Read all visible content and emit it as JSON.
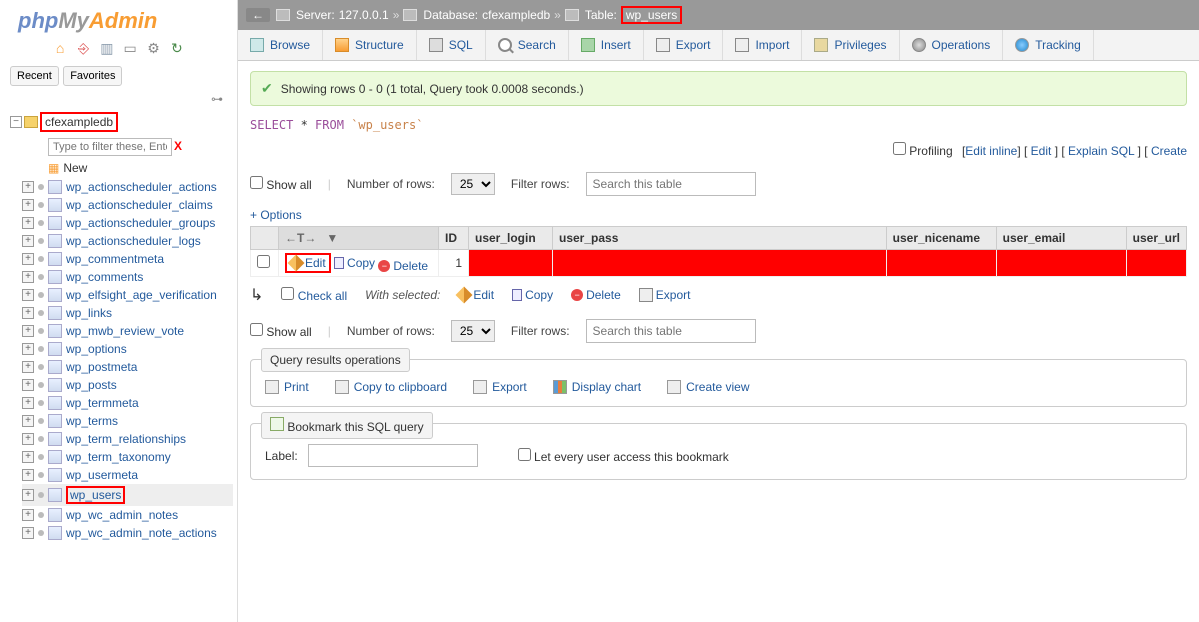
{
  "logo": {
    "p1": "php",
    "p2": "My",
    "p3": "Admin"
  },
  "rf": {
    "recent": "Recent",
    "favorites": "Favorites"
  },
  "tree": {
    "db": "cfexampledb",
    "filter_ph": "Type to filter these, Enter to s",
    "new": "New",
    "tables": [
      "wp_actionscheduler_actions",
      "wp_actionscheduler_claims",
      "wp_actionscheduler_groups",
      "wp_actionscheduler_logs",
      "wp_commentmeta",
      "wp_comments",
      "wp_elfsight_age_verification",
      "wp_links",
      "wp_mwb_review_vote",
      "wp_options",
      "wp_postmeta",
      "wp_posts",
      "wp_termmeta",
      "wp_terms",
      "wp_term_relationships",
      "wp_term_taxonomy",
      "wp_usermeta",
      "wp_users",
      "wp_wc_admin_notes",
      "wp_wc_admin_note_actions"
    ],
    "selected_index": 17
  },
  "crumb": {
    "server_lbl": "Server:",
    "server": "127.0.0.1",
    "db_lbl": "Database:",
    "db": "cfexampledb",
    "table_lbl": "Table:",
    "table": "wp_users",
    "sep": "»"
  },
  "tabs": {
    "browse": "Browse",
    "structure": "Structure",
    "sql": "SQL",
    "search": "Search",
    "insert": "Insert",
    "export": "Export",
    "import": "Import",
    "privileges": "Privileges",
    "operations": "Operations",
    "tracking": "Tracking"
  },
  "msg": "Showing rows 0 - 0 (1 total, Query took 0.0008 seconds.)",
  "sql": {
    "kw1": "SELECT",
    "star": " * ",
    "kw2": "FROM",
    "tbl": "`wp_users`"
  },
  "links": {
    "profiling": "Profiling",
    "edit_inline": "Edit inline",
    "edit": "Edit",
    "explain": "Explain SQL",
    "create": "Create"
  },
  "filterbar": {
    "show_all": "Show all",
    "num_rows_lbl": "Number of rows:",
    "num_rows_val": "25",
    "filter_lbl": "Filter rows:",
    "filter_ph": "Search this table"
  },
  "options": "+ Options",
  "thead": {
    "id": "ID",
    "user_login": "user_login",
    "user_pass": "user_pass",
    "user_nicename": "user_nicename",
    "user_email": "user_email",
    "user_url": "user_url"
  },
  "row": {
    "edit": "Edit",
    "copy": "Copy",
    "delete": "Delete",
    "id": "1"
  },
  "check": {
    "check_all": "Check all",
    "with_selected": "With selected:",
    "edit": "Edit",
    "copy": "Copy",
    "delete": "Delete",
    "export": "Export"
  },
  "qops": {
    "legend": "Query results operations",
    "print": "Print",
    "copy_clip": "Copy to clipboard",
    "export": "Export",
    "chart": "Display chart",
    "view": "Create view"
  },
  "bkm": {
    "legend": "Bookmark this SQL query",
    "label": "Label:",
    "every": "Let every user access this bookmark"
  }
}
